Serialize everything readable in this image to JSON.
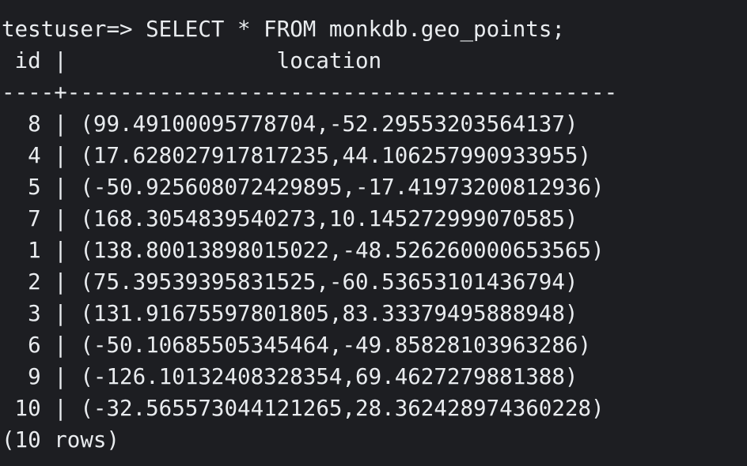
{
  "terminal": {
    "prompt": "testuser=> ",
    "command": "SELECT * FROM monkdb.geo_points;",
    "header": " id |                location",
    "separator": "----+------------------------------------------",
    "rows": [
      "  8 | (99.49100095778704,-52.29553203564137)",
      "  4 | (17.628027917817235,44.106257990933955)",
      "  5 | (-50.925608072429895,-17.41973200812936)",
      "  7 | (168.3054839540273,10.145272999070585)",
      "  1 | (138.80013898015022,-48.526260000653565)",
      "  2 | (75.39539395831525,-60.53653101436794)",
      "  3 | (131.91675597801805,83.33379495888948)",
      "  6 | (-50.10685505345464,-49.85828103963286)",
      "  9 | (-126.10132408328354,69.4627279881388)",
      " 10 | (-32.565573044121265,28.362428974360228)"
    ],
    "footer": "(10 rows)"
  }
}
